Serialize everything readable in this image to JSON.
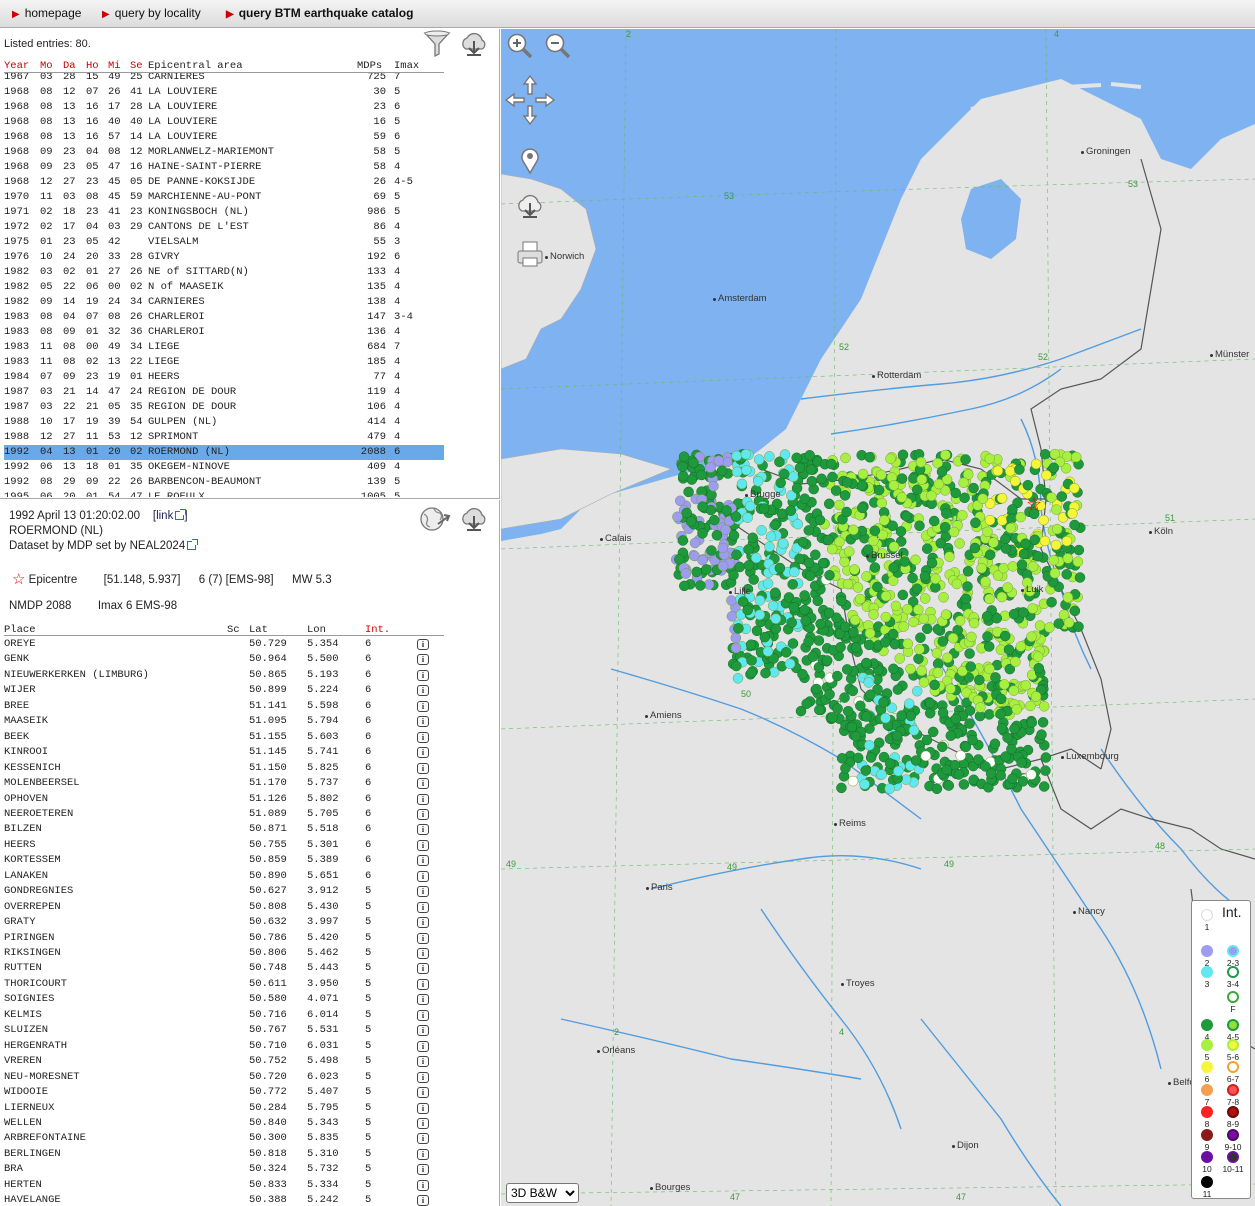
{
  "nav": {
    "homepage": "homepage",
    "query_locality": "query by locality",
    "query_catalog": "query BTM earthquake catalog"
  },
  "catalog": {
    "listed": "Listed entries: 80.",
    "columns": [
      "Year",
      "Mo",
      "Da",
      "Ho",
      "Mi",
      "Se",
      "Epicentral area",
      "MDPs",
      "Imax"
    ],
    "rows": [
      [
        "1967",
        "03",
        "28",
        "15",
        "49",
        "25",
        "CARNIERES",
        "725",
        "7"
      ],
      [
        "1968",
        "08",
        "12",
        "07",
        "26",
        "41",
        "LA LOUVIERE",
        "30",
        "5"
      ],
      [
        "1968",
        "08",
        "13",
        "16",
        "17",
        "28",
        "LA LOUVIERE",
        "23",
        "6"
      ],
      [
        "1968",
        "08",
        "13",
        "16",
        "40",
        "40",
        "LA LOUVIERE",
        "16",
        "5"
      ],
      [
        "1968",
        "08",
        "13",
        "16",
        "57",
        "14",
        "LA LOUVIERE",
        "59",
        "6"
      ],
      [
        "1968",
        "09",
        "23",
        "04",
        "08",
        "12",
        "MORLANWELZ-MARIEMONT",
        "58",
        "5"
      ],
      [
        "1968",
        "09",
        "23",
        "05",
        "47",
        "16",
        "HAINE-SAINT-PIERRE",
        "58",
        "4"
      ],
      [
        "1968",
        "12",
        "27",
        "23",
        "45",
        "05",
        "DE PANNE-KOKSIJDE",
        "26",
        "4-5"
      ],
      [
        "1970",
        "11",
        "03",
        "08",
        "45",
        "59",
        "MARCHIENNE-AU-PONT",
        "69",
        "5"
      ],
      [
        "1971",
        "02",
        "18",
        "23",
        "41",
        "23",
        "KONINGSBOCH (NL)",
        "986",
        "5"
      ],
      [
        "1972",
        "02",
        "17",
        "04",
        "03",
        "29",
        "CANTONS DE L'EST",
        "86",
        "4"
      ],
      [
        "1975",
        "01",
        "23",
        "05",
        "42",
        "",
        "VIELSALM",
        "55",
        "3"
      ],
      [
        "1976",
        "10",
        "24",
        "20",
        "33",
        "28",
        "GIVRY",
        "192",
        "6"
      ],
      [
        "1982",
        "03",
        "02",
        "01",
        "27",
        "26",
        "NE of SITTARD(N)",
        "133",
        "4"
      ],
      [
        "1982",
        "05",
        "22",
        "06",
        "00",
        "02",
        "N of MAASEIK",
        "135",
        "4"
      ],
      [
        "1982",
        "09",
        "14",
        "19",
        "24",
        "34",
        "CARNIERES",
        "138",
        "4"
      ],
      [
        "1983",
        "08",
        "04",
        "07",
        "08",
        "26",
        "CHARLEROI",
        "147",
        "3-4"
      ],
      [
        "1983",
        "08",
        "09",
        "01",
        "32",
        "36",
        "CHARLEROI",
        "136",
        "4"
      ],
      [
        "1983",
        "11",
        "08",
        "00",
        "49",
        "34",
        "LIEGE",
        "684",
        "7"
      ],
      [
        "1983",
        "11",
        "08",
        "02",
        "13",
        "22",
        "LIEGE",
        "185",
        "4"
      ],
      [
        "1984",
        "07",
        "09",
        "23",
        "19",
        "01",
        "HEERS",
        "77",
        "4"
      ],
      [
        "1987",
        "03",
        "21",
        "14",
        "47",
        "24",
        "REGION DE DOUR",
        "119",
        "4"
      ],
      [
        "1987",
        "03",
        "22",
        "21",
        "05",
        "35",
        "REGION DE DOUR",
        "106",
        "4"
      ],
      [
        "1988",
        "10",
        "17",
        "19",
        "39",
        "54",
        "GULPEN (NL)",
        "414",
        "4"
      ],
      [
        "1988",
        "12",
        "27",
        "11",
        "53",
        "12",
        "SPRIMONT",
        "479",
        "4"
      ],
      [
        "1992",
        "04",
        "13",
        "01",
        "20",
        "02",
        "ROERMOND (NL)",
        "2088",
        "6"
      ],
      [
        "1992",
        "06",
        "13",
        "18",
        "01",
        "35",
        "OKEGEM-NINOVE",
        "409",
        "4"
      ],
      [
        "1992",
        "08",
        "29",
        "09",
        "22",
        "26",
        "BARBENCON-BEAUMONT",
        "139",
        "5"
      ],
      [
        "1995",
        "06",
        "20",
        "01",
        "54",
        "47",
        "LE ROEULX",
        "1005",
        "5"
      ]
    ],
    "selected_index": 25
  },
  "event": {
    "datetime": "1992 April 13    01:20:02.00",
    "link_label": "[link",
    "link_close": "]",
    "area": "ROERMOND (NL)",
    "dataset": "Dataset by MDP set by NEAL2024",
    "epicentre_label": "Epicentre",
    "coords": "[51.148, 5.937]",
    "intensity": "6 (7) [EMS-98]",
    "magnitude": "MW 5.3",
    "nmdp": "NMDP 2088",
    "imax": "Imax 6 EMS-98"
  },
  "places": {
    "columns": [
      "Place",
      "Sc",
      "Lat",
      "Lon",
      "Int."
    ],
    "info_label": "i",
    "rows": [
      [
        "OREYE",
        "50.729",
        "5.354",
        "6"
      ],
      [
        "GENK",
        "50.964",
        "5.500",
        "6"
      ],
      [
        "NIEUWERKERKEN (LIMBURG)",
        "50.865",
        "5.193",
        "6"
      ],
      [
        "WIJER",
        "50.899",
        "5.224",
        "6"
      ],
      [
        "BREE",
        "51.141",
        "5.598",
        "6"
      ],
      [
        "MAASEIK",
        "51.095",
        "5.794",
        "6"
      ],
      [
        "BEEK",
        "51.155",
        "5.603",
        "6"
      ],
      [
        "KINROOI",
        "51.145",
        "5.741",
        "6"
      ],
      [
        "KESSENICH",
        "51.150",
        "5.825",
        "6"
      ],
      [
        "MOLENBEERSEL",
        "51.170",
        "5.737",
        "6"
      ],
      [
        "OPHOVEN",
        "51.126",
        "5.802",
        "6"
      ],
      [
        "NEEROETEREN",
        "51.089",
        "5.705",
        "6"
      ],
      [
        "BILZEN",
        "50.871",
        "5.518",
        "6"
      ],
      [
        "HEERS",
        "50.755",
        "5.301",
        "6"
      ],
      [
        "KORTESSEM",
        "50.859",
        "5.389",
        "6"
      ],
      [
        "LANAKEN",
        "50.890",
        "5.651",
        "6"
      ],
      [
        "GONDREGNIES",
        "50.627",
        "3.912",
        "5"
      ],
      [
        "OVERREPEN",
        "50.808",
        "5.430",
        "5"
      ],
      [
        "GRATY",
        "50.632",
        "3.997",
        "5"
      ],
      [
        "PIRINGEN",
        "50.786",
        "5.420",
        "5"
      ],
      [
        "RIKSINGEN",
        "50.806",
        "5.462",
        "5"
      ],
      [
        "RUTTEN",
        "50.748",
        "5.443",
        "5"
      ],
      [
        "THORICOURT",
        "50.611",
        "3.950",
        "5"
      ],
      [
        "SOIGNIES",
        "50.580",
        "4.071",
        "5"
      ],
      [
        "KELMIS",
        "50.716",
        "6.014",
        "5"
      ],
      [
        "SLUIZEN",
        "50.767",
        "5.531",
        "5"
      ],
      [
        "HERGENRATH",
        "50.710",
        "6.031",
        "5"
      ],
      [
        "VREREN",
        "50.752",
        "5.498",
        "5"
      ],
      [
        "NEU-MORESNET",
        "50.720",
        "6.023",
        "5"
      ],
      [
        "WIDOOIE",
        "50.772",
        "5.407",
        "5"
      ],
      [
        "LIERNEUX",
        "50.284",
        "5.795",
        "5"
      ],
      [
        "WELLEN",
        "50.840",
        "5.343",
        "5"
      ],
      [
        "ARBREFONTAINE",
        "50.300",
        "5.835",
        "5"
      ],
      [
        "BERLINGEN",
        "50.818",
        "5.310",
        "5"
      ],
      [
        "BRA",
        "50.324",
        "5.732",
        "5"
      ],
      [
        "HERTEN",
        "50.833",
        "5.334",
        "5"
      ],
      [
        "HAVELANGE",
        "50.388",
        "5.242",
        "5"
      ]
    ]
  },
  "map": {
    "cities": [
      "Groningen",
      "Norwich",
      "Amsterdam",
      "Rotterdam",
      "Münster",
      "Brugge",
      "Brussel",
      "Calais",
      "Lille",
      "Luik",
      "Köln",
      "Amiens",
      "Luxembourg",
      "Reims",
      "Paris",
      "Nancy",
      "Troyes",
      "Orléans",
      "Belfort",
      "Dijon",
      "Bourges"
    ],
    "grid_labels": [
      "53",
      "53",
      "52",
      "52",
      "51",
      "51",
      "50",
      "50",
      "49",
      "49",
      "49",
      "48",
      "47",
      "47",
      "4",
      "4",
      "2",
      "2",
      "4"
    ],
    "basemap_option": "3D B&W",
    "colors": {
      "sea": "#7fb2f0",
      "land": "#e4e4e4",
      "river": "#4f9ce0",
      "border": "#555555"
    }
  },
  "legend": {
    "title": "Int.",
    "items": [
      {
        "label": "1",
        "color": "#ffffff",
        "ring": false
      },
      {
        "label": "2",
        "color": "#9c9cf0",
        "ring": false
      },
      {
        "label": "2-3",
        "color": "#9c9cf0",
        "ring": true,
        "ringcolor": "#5fe8f0"
      },
      {
        "label": "3",
        "color": "#5fe8f0",
        "ring": false
      },
      {
        "label": "3-4",
        "color": "#ffffff",
        "ring": true,
        "ringcolor": "#1e9a4a"
      },
      {
        "label": "F",
        "color": "#ffffff",
        "ring": true,
        "ringcolor": "#3aaa3a"
      },
      {
        "label": "4",
        "color": "#1e9a3c",
        "ring": false
      },
      {
        "label": "4-5",
        "color": "#8ee03a",
        "ring": true,
        "ringcolor": "#1e9a3c"
      },
      {
        "label": "5",
        "color": "#a8f040",
        "ring": false
      },
      {
        "label": "5-6",
        "color": "#f5f53a",
        "ring": true,
        "ringcolor": "#a8f040"
      },
      {
        "label": "6",
        "color": "#f5f53a",
        "ring": false
      },
      {
        "label": "6-7",
        "color": "#ffffff",
        "ring": true,
        "ringcolor": "#f5a030"
      },
      {
        "label": "7",
        "color": "#f5a050",
        "ring": false
      },
      {
        "label": "7-8",
        "color": "#ff5050",
        "ring": true,
        "ringcolor": "#cc2020"
      },
      {
        "label": "8",
        "color": "#ff2020",
        "ring": false
      },
      {
        "label": "8-9",
        "color": "#b01010",
        "ring": true,
        "ringcolor": "#6a0a0a"
      },
      {
        "label": "9",
        "color": "#8a1a1a",
        "ring": false
      },
      {
        "label": "9-10",
        "color": "#7a10a0",
        "ring": true,
        "ringcolor": "#4a0a6a"
      },
      {
        "label": "10",
        "color": "#6a10a0",
        "ring": false
      },
      {
        "label": "10-11",
        "color": "#333333",
        "ring": true,
        "ringcolor": "#6a10a0"
      },
      {
        "label": "11",
        "color": "#000000",
        "ring": false
      }
    ]
  }
}
